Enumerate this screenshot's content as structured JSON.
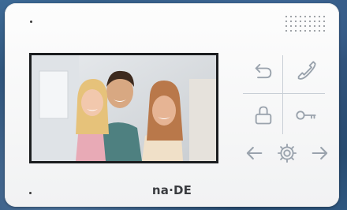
{
  "brand": {
    "logo_text": "na·DE"
  },
  "screen": {
    "content": "family-photo"
  },
  "colors": {
    "device_body": "#f6f7f8",
    "icon_stroke": "#9aa3ad",
    "logo": "#3a3c40"
  },
  "touch_buttons": [
    {
      "id": "back",
      "icon": "back-arrow-icon"
    },
    {
      "id": "call",
      "icon": "handset-icon"
    },
    {
      "id": "monitor",
      "icon": "user-icon"
    },
    {
      "id": "unlock",
      "icon": "key-icon"
    },
    {
      "id": "prev",
      "icon": "arrow-left-icon"
    },
    {
      "id": "settings",
      "icon": "gear-icon"
    },
    {
      "id": "next",
      "icon": "arrow-right-icon"
    }
  ]
}
